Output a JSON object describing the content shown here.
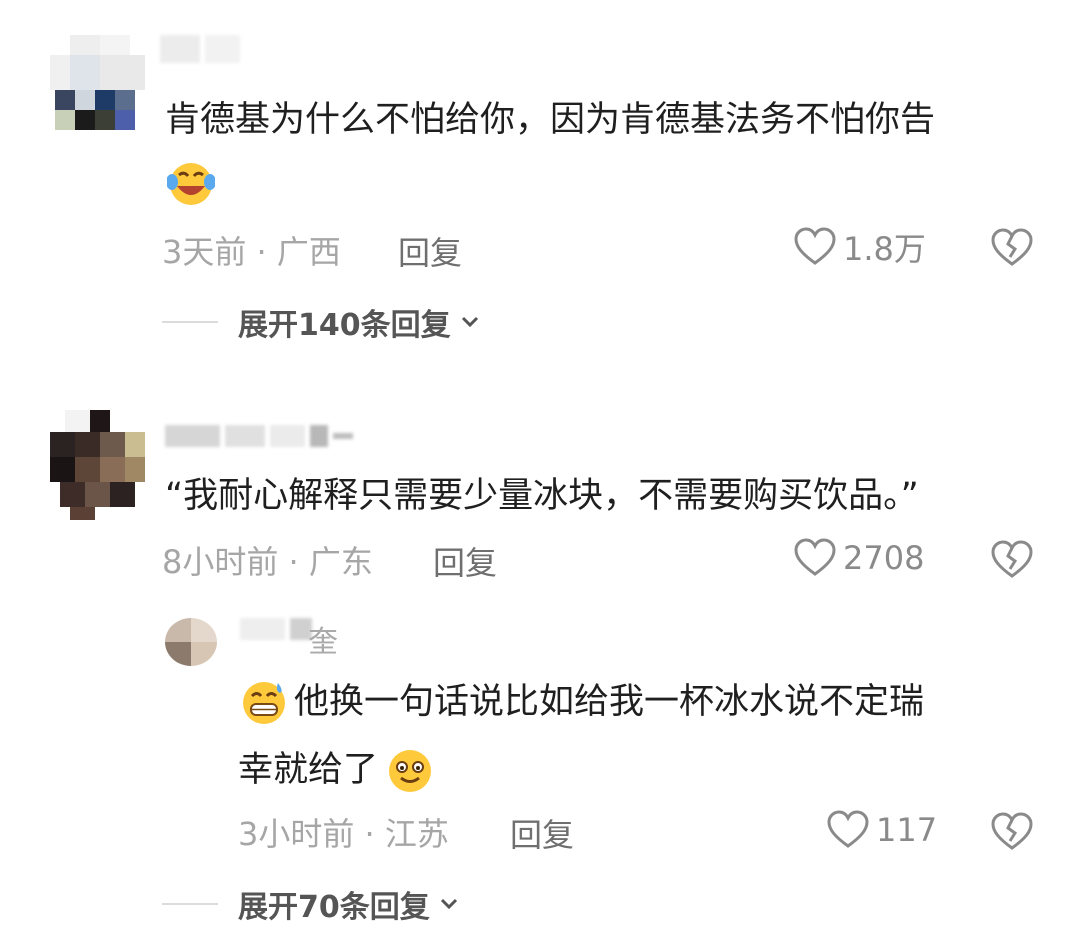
{
  "comments": [
    {
      "text_line1": "肯德基为什么不怕给你，因为肯德基法务不怕你告",
      "time_location": "3天前 · 广西",
      "reply_label": "回复",
      "likes": "1.8万",
      "expand_label": "展开140条回复",
      "trailing_emoji": "laugh-cry-emoji"
    },
    {
      "text_line1": "“我耐心解释只需要少量冰块，不需要购买饮品。”",
      "time_location": "8小时前 · 广东",
      "reply_label": "回复",
      "likes": "2708",
      "reply": {
        "username_visible": "奎",
        "text_line1": "他换一句话说比如给我一杯冰水说不定瑞",
        "text_line2": "幸就给了",
        "time_location": "3小时前 · 江苏",
        "reply_label": "回复",
        "likes": "117",
        "leading_emoji": "grin-sweat-emoji",
        "trailing_emoji": "smile-emoji"
      },
      "expand_label": "展开70条回复"
    }
  ],
  "colors": {
    "text": "#1f1f1f",
    "meta": "#a6a6a6",
    "icon": "#888888",
    "background": "#ffffff"
  }
}
